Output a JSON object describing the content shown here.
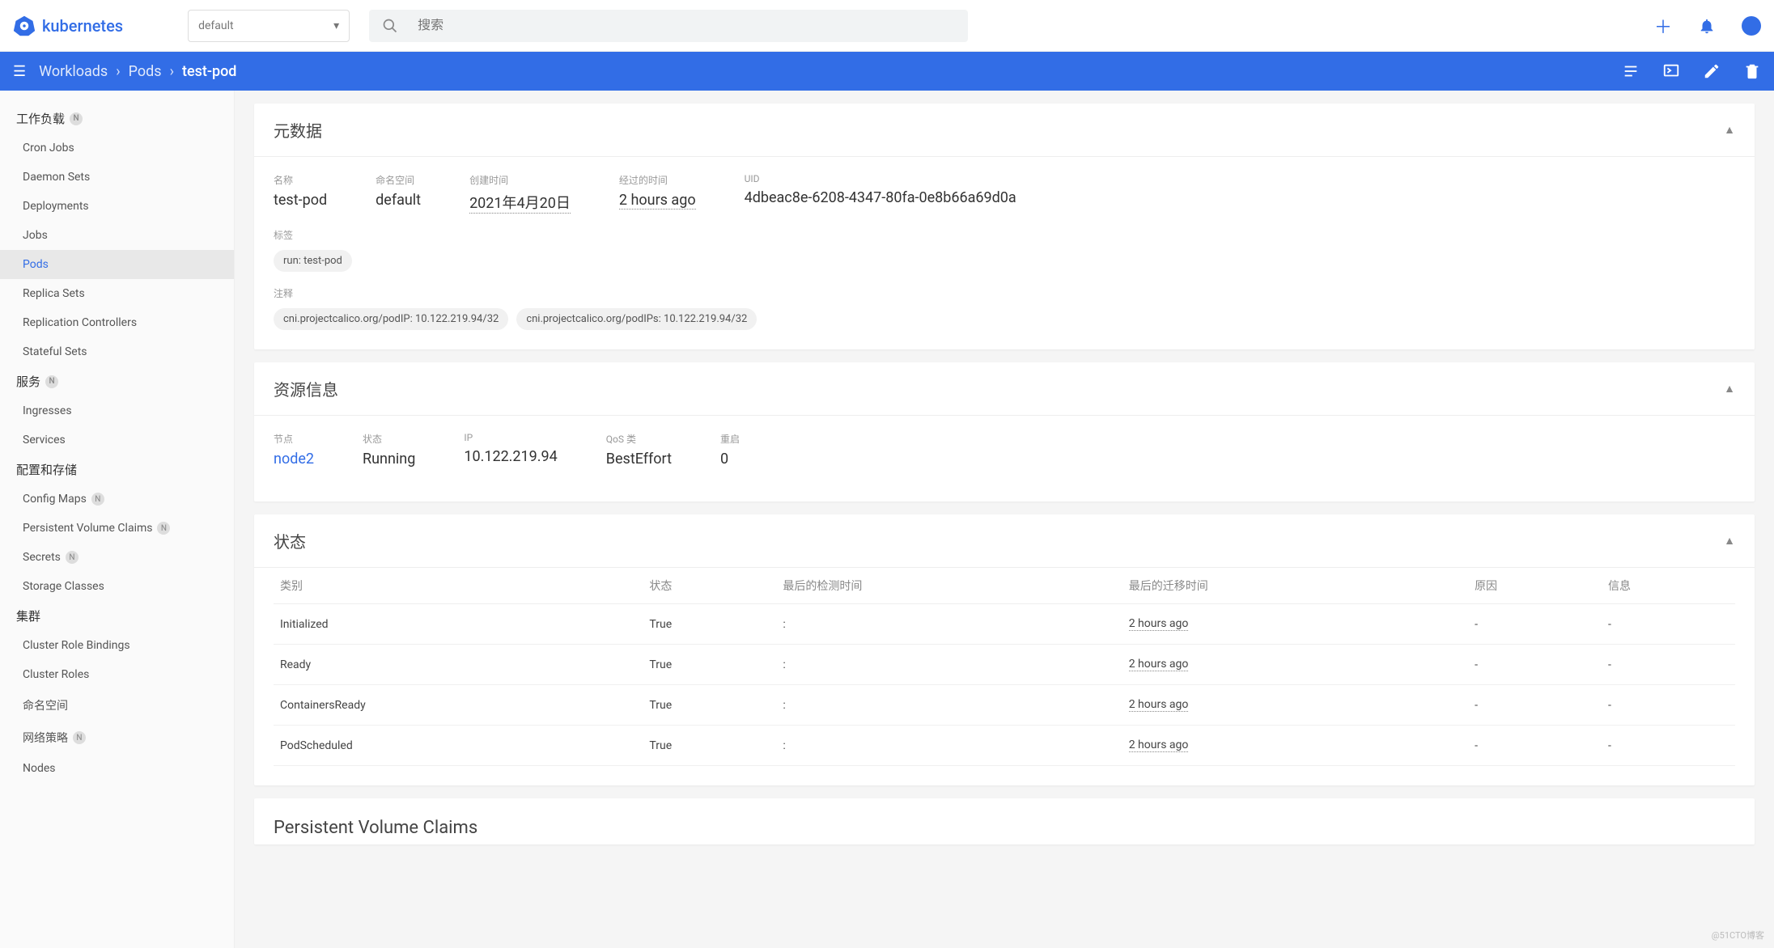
{
  "brand": "kubernetes",
  "namespace": "default",
  "search_placeholder": "搜索",
  "breadcrumb": {
    "a": "Workloads",
    "b": "Pods",
    "c": "test-pod"
  },
  "sidebar": {
    "workloads": {
      "title": "工作负载",
      "items": [
        "Cron Jobs",
        "Daemon Sets",
        "Deployments",
        "Jobs",
        "Pods",
        "Replica Sets",
        "Replication Controllers",
        "Stateful Sets"
      ],
      "active": "Pods"
    },
    "services": {
      "title": "服务",
      "items": [
        "Ingresses",
        "Services"
      ]
    },
    "config": {
      "title": "配置和存储",
      "items": [
        "Config Maps",
        "Persistent Volume Claims",
        "Secrets",
        "Storage Classes"
      ],
      "badged": [
        "Config Maps",
        "Persistent Volume Claims",
        "Secrets"
      ]
    },
    "cluster": {
      "title": "集群",
      "items": [
        "Cluster Role Bindings",
        "Cluster Roles",
        "命名空间",
        "网络策略",
        "Nodes"
      ],
      "badged": [
        "网络策略"
      ]
    }
  },
  "metadata": {
    "title": "元数据",
    "name_label": "名称",
    "name": "test-pod",
    "ns_label": "命名空间",
    "ns": "default",
    "created_label": "创建时间",
    "created": "2021年4月20日",
    "age_label": "经过的时间",
    "age": "2 hours ago",
    "uid_label": "UID",
    "uid": "4dbeac8e-6208-4347-80fa-0e8b66a69d0a",
    "labels_label": "标签",
    "labels": [
      "run: test-pod"
    ],
    "ann_label": "注释",
    "annotations": [
      "cni.projectcalico.org/podIP: 10.122.219.94/32",
      "cni.projectcalico.org/podIPs: 10.122.219.94/32"
    ]
  },
  "resource": {
    "title": "资源信息",
    "node_label": "节点",
    "node": "node2",
    "status_label": "状态",
    "status": "Running",
    "ip_label": "IP",
    "ip": "10.122.219.94",
    "qos_label": "QoS 类",
    "qos": "BestEffort",
    "restart_label": "重启",
    "restart": "0"
  },
  "status": {
    "title": "状态",
    "headers": [
      "类别",
      "状态",
      "最后的检测时间",
      "最后的迁移时间",
      "原因",
      "信息"
    ],
    "rows": [
      {
        "type": "Initialized",
        "status": "True",
        "probe": ":",
        "transition": "2 hours ago",
        "reason": "-",
        "msg": "-"
      },
      {
        "type": "Ready",
        "status": "True",
        "probe": ":",
        "transition": "2 hours ago",
        "reason": "-",
        "msg": "-"
      },
      {
        "type": "ContainersReady",
        "status": "True",
        "probe": ":",
        "transition": "2 hours ago",
        "reason": "-",
        "msg": "-"
      },
      {
        "type": "PodScheduled",
        "status": "True",
        "probe": ":",
        "transition": "2 hours ago",
        "reason": "-",
        "msg": "-"
      }
    ]
  },
  "pvc_title": "Persistent Volume Claims",
  "watermark": "@51CTO博客"
}
